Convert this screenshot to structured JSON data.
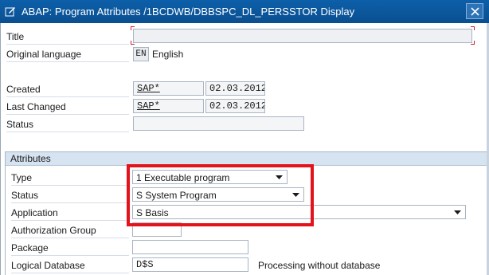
{
  "window": {
    "title": "ABAP: Program Attributes /1BCDWB/DBBSPC_DL_PERSSTOR Display",
    "title_icon": "edit-document-icon",
    "close_icon": "close-icon"
  },
  "header_fields": {
    "title_label": "Title",
    "title_value": "",
    "original_language_label": "Original language",
    "language_code": "EN",
    "language_name": "English",
    "created_label": "Created",
    "created_by": "SAP*",
    "created_date": "02.03.2012",
    "last_changed_label": "Last Changed",
    "last_changed_by": "SAP*",
    "last_changed_date": "02.03.2012",
    "status_label": "Status",
    "status_value": ""
  },
  "attributes": {
    "group_title": "Attributes",
    "type_label": "Type",
    "type_value": "1 Executable program",
    "status_label": "Status",
    "status_value": "S System Program",
    "application_label": "Application",
    "application_value": "S Basis",
    "auth_group_label": "Authorization Group",
    "auth_group_value": "",
    "package_label": "Package",
    "package_value": "",
    "logical_db_label": "Logical Database",
    "logical_db_value": "D$S",
    "logical_db_desc": "Processing without database"
  },
  "colors": {
    "titlebar": "#0d5fa9",
    "highlight": "#e3121b",
    "group_header": "#d6e3f1"
  }
}
